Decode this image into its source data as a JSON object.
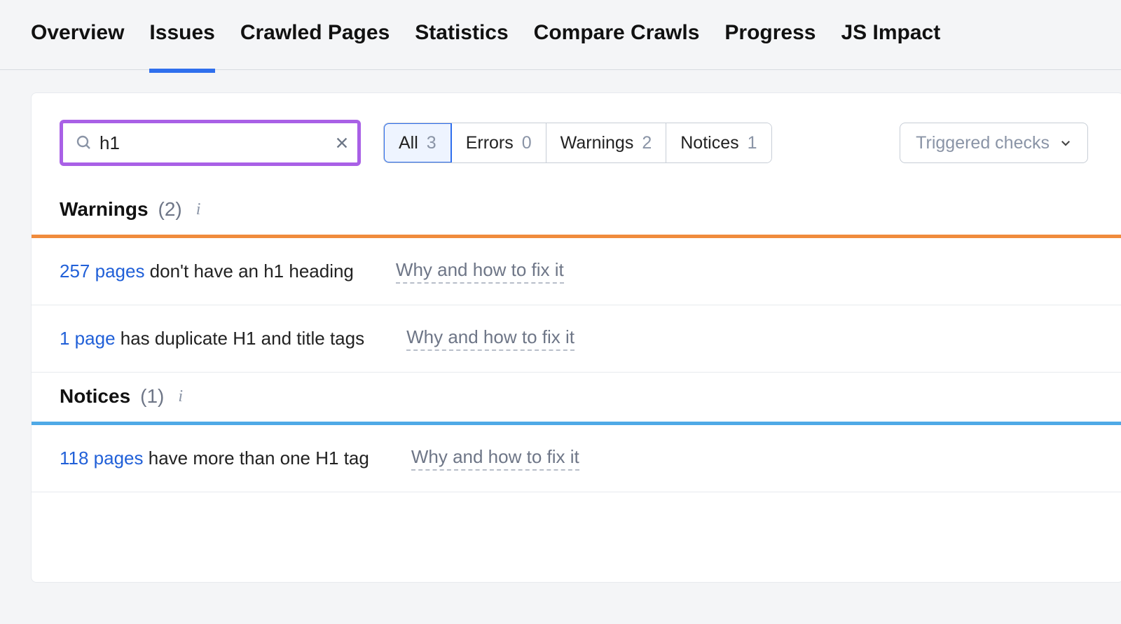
{
  "tabs": {
    "overview": "Overview",
    "issues": "Issues",
    "crawled_pages": "Crawled Pages",
    "statistics": "Statistics",
    "compare_crawls": "Compare Crawls",
    "progress": "Progress",
    "js_impact": "JS Impact"
  },
  "search": {
    "value": "h1"
  },
  "filters": {
    "all_label": "All",
    "all_count": "3",
    "errors_label": "Errors",
    "errors_count": "0",
    "warnings_label": "Warnings",
    "warnings_count": "2",
    "notices_label": "Notices",
    "notices_count": "1"
  },
  "triggered_label": "Triggered checks",
  "sections": {
    "warnings_title": "Warnings",
    "warnings_count": "(2)",
    "notices_title": "Notices",
    "notices_count": "(1)"
  },
  "issues": {
    "w1_link": "257 pages",
    "w1_text": " don't have an h1 heading",
    "w2_link": "1 page",
    "w2_text": " has duplicate H1 and title tags",
    "n1_link": "118 pages",
    "n1_text": " have more than one H1 tag",
    "fix_label": "Why and how to fix it"
  }
}
